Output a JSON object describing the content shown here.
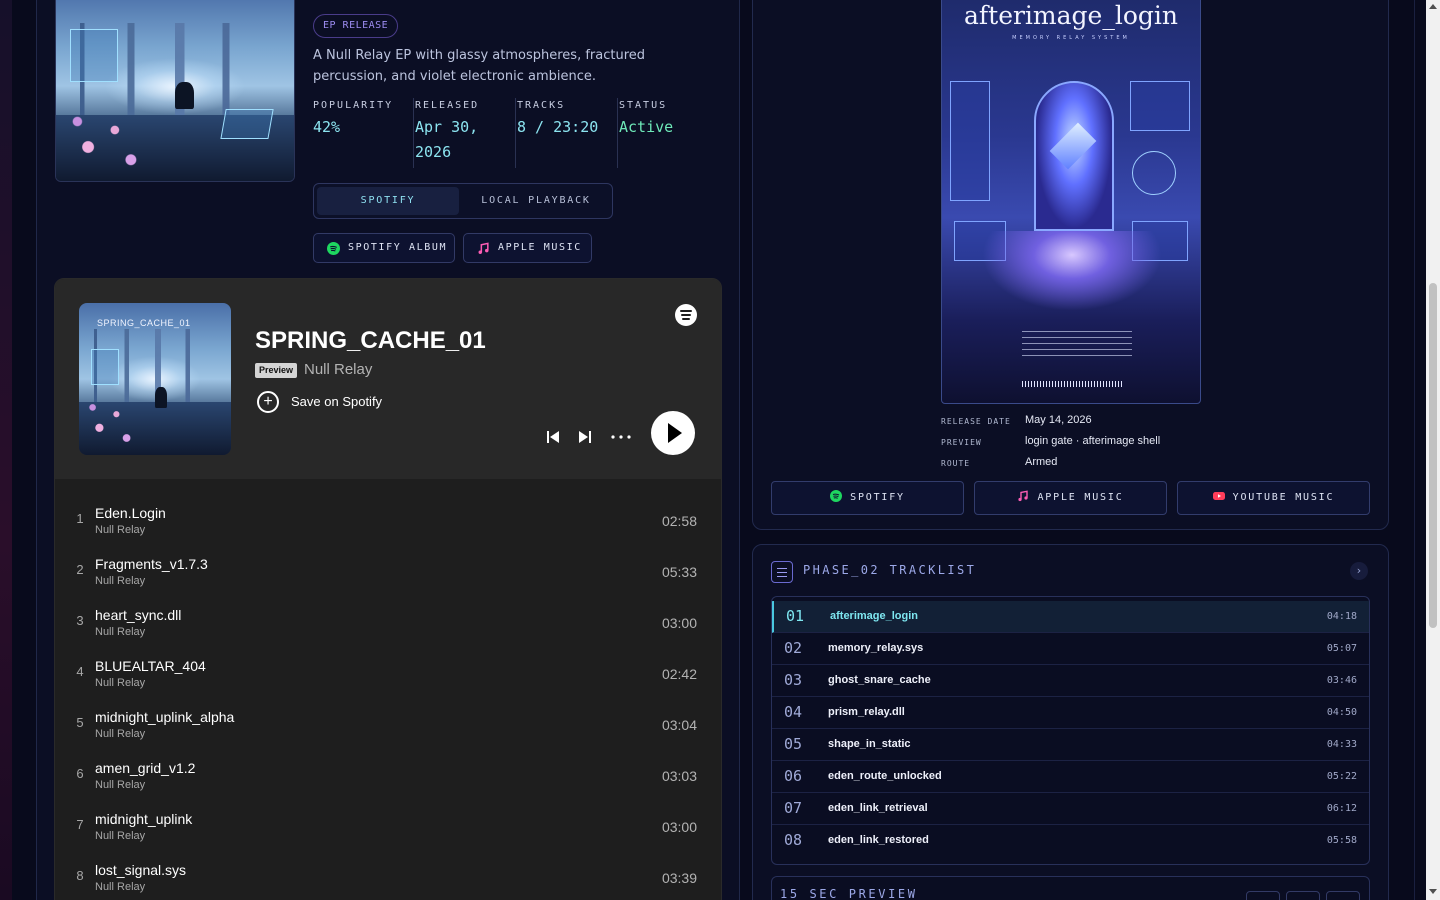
{
  "ep": {
    "badge": "EP RELEASE",
    "description": "A Null Relay EP with glassy atmospheres, fractured percussion, and violet electronic ambience.",
    "stats": [
      {
        "label": "POPULARITY",
        "value": "42%"
      },
      {
        "label": "RELEASED",
        "value": "Apr 30, 2026"
      },
      {
        "label": "TRACKS",
        "value": "8 / 23:20"
      },
      {
        "label": "STATUS",
        "value": "Active"
      }
    ],
    "mode_tabs": [
      "SPOTIFY",
      "LOCAL PLAYBACK"
    ],
    "links": [
      "SPOTIFY ALBUM",
      "APPLE MUSIC"
    ]
  },
  "embed": {
    "art_label": "SPRING_CACHE_01",
    "title": "SPRING_CACHE_01",
    "preview_tag": "Preview",
    "artist": "Null Relay",
    "save_label": "Save on Spotify",
    "tracks": [
      {
        "n": "1",
        "title": "Eden.Login",
        "artist": "Null Relay",
        "dur": "02:58"
      },
      {
        "n": "2",
        "title": "Fragments_v1.7.3",
        "artist": "Null Relay",
        "dur": "05:33"
      },
      {
        "n": "3",
        "title": "heart_sync.dll",
        "artist": "Null Relay",
        "dur": "03:00"
      },
      {
        "n": "4",
        "title": "BLUEALTAR_404",
        "artist": "Null Relay",
        "dur": "02:42"
      },
      {
        "n": "5",
        "title": "midnight_uplink_alpha",
        "artist": "Null Relay",
        "dur": "03:04"
      },
      {
        "n": "6",
        "title": "amen_grid_v1.2",
        "artist": "Null Relay",
        "dur": "03:03"
      },
      {
        "n": "7",
        "title": "midnight_uplink",
        "artist": "Null Relay",
        "dur": "03:00"
      },
      {
        "n": "8",
        "title": "lost_signal.sys",
        "artist": "Null Relay",
        "dur": "03:39"
      }
    ]
  },
  "single": {
    "poster_title": "afterimage_login",
    "poster_subtitle": "MEMORY RELAY SYSTEM",
    "meta": [
      {
        "key": "RELEASE DATE",
        "value": "May 14, 2026"
      },
      {
        "key": "PREVIEW",
        "value": "login gate · afterimage shell"
      },
      {
        "key": "ROUTE",
        "value": "Armed"
      }
    ],
    "platforms": [
      "SPOTIFY",
      "APPLE MUSIC",
      "YOUTUBE MUSIC"
    ]
  },
  "tracklist": {
    "title": "PHASE_02 TRACKLIST",
    "rows": [
      {
        "no": "01",
        "name": "afterimage_login",
        "dur": "04:18"
      },
      {
        "no": "02",
        "name": "memory_relay.sys",
        "dur": "05:07"
      },
      {
        "no": "03",
        "name": "ghost_snare_cache",
        "dur": "03:46"
      },
      {
        "no": "04",
        "name": "prism_relay.dll",
        "dur": "04:50"
      },
      {
        "no": "05",
        "name": "shape_in_static",
        "dur": "04:33"
      },
      {
        "no": "06",
        "name": "eden_route_unlocked",
        "dur": "05:22"
      },
      {
        "no": "07",
        "name": "eden_link_retrieval",
        "dur": "06:12"
      },
      {
        "no": "08",
        "name": "eden_link_restored",
        "dur": "05:58"
      }
    ]
  },
  "preview_section": {
    "title": "15 SEC PREVIEW"
  },
  "colors": {
    "accent": "#8ce4f0",
    "status_active": "#6ee8b8",
    "violet": "#9c8cf0",
    "spotify_green": "#1ed760",
    "youtube_red": "#ff3d5a",
    "apple_pink": "#fc5cb4"
  }
}
